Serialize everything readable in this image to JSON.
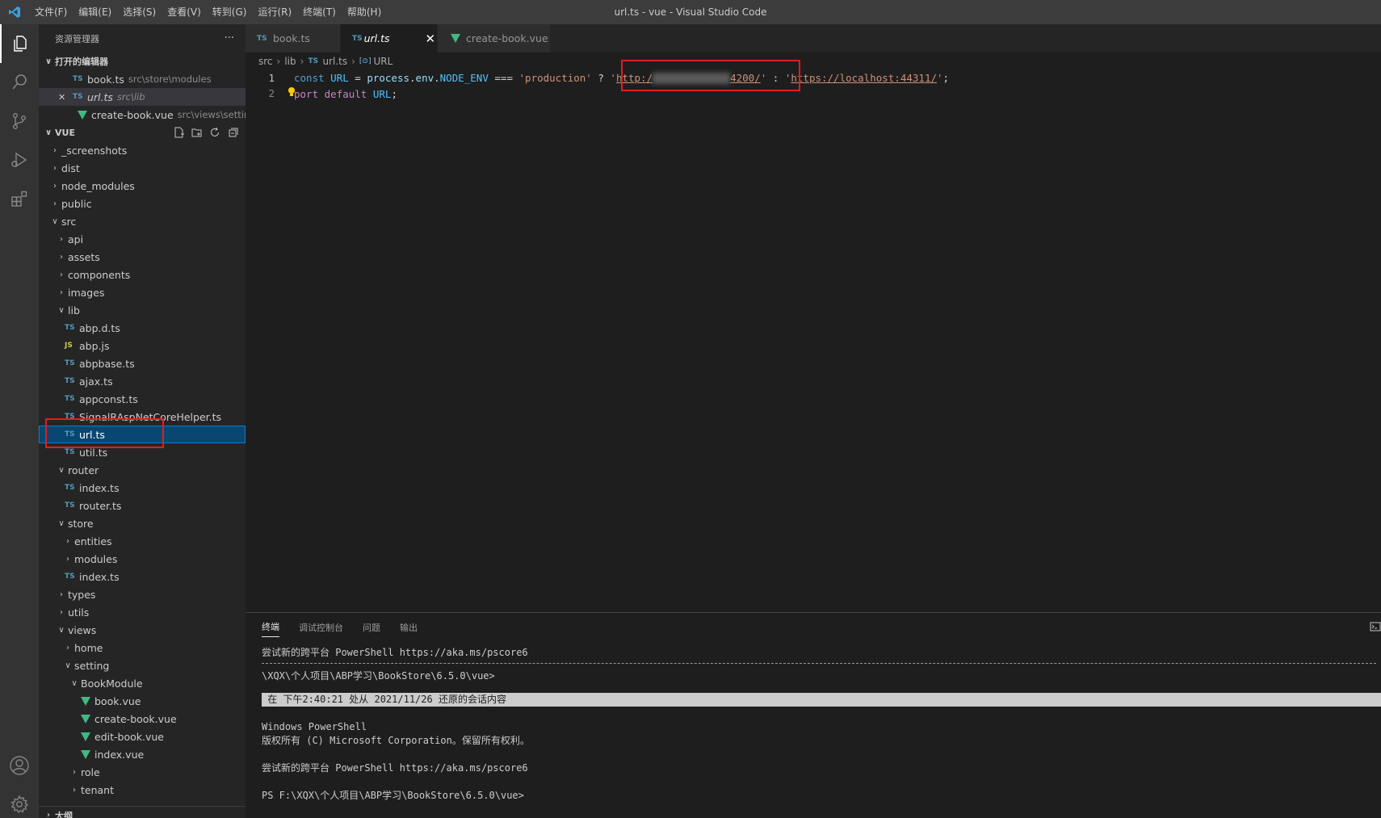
{
  "window": {
    "title": "url.ts - vue - Visual Studio Code"
  },
  "menu": [
    "文件(F)",
    "编辑(E)",
    "选择(S)",
    "查看(V)",
    "转到(G)",
    "运行(R)",
    "终端(T)",
    "帮助(H)"
  ],
  "activity_bar": [
    "explorer-icon",
    "search-icon",
    "source-control-icon",
    "run-debug-icon",
    "extensions-icon",
    "account-icon",
    "gear-icon"
  ],
  "sidebar": {
    "title": "资源管理器",
    "more": "···",
    "open_editors": {
      "title": "打开的编辑器",
      "items": [
        {
          "name": "book.ts",
          "path": "src\\store\\modules"
        },
        {
          "name": "url.ts",
          "path": "src\\lib",
          "close": "✕"
        },
        {
          "name": "create-book.vue",
          "path": "src\\views\\settin..."
        }
      ]
    },
    "workspace": {
      "title": "VUE",
      "tree": [
        "_screenshots",
        "dist",
        "node_modules",
        "public",
        "src",
        "api",
        "assets",
        "components",
        "images",
        "lib",
        "abp.d.ts",
        "abp.js",
        "abpbase.ts",
        "ajax.ts",
        "appconst.ts",
        "SignalRAspNetCoreHelper.ts",
        "url.ts",
        "util.ts",
        "router",
        "index.ts",
        "router.ts",
        "store",
        "entities",
        "modules",
        "index.ts",
        "types",
        "utils",
        "views",
        "home",
        "setting",
        "BookModule",
        "book.vue",
        "create-book.vue",
        "edit-book.vue",
        "index.vue",
        "role",
        "tenant"
      ]
    },
    "outline_title": "大纲"
  },
  "tabs": [
    {
      "label": "book.ts",
      "badge": "TS"
    },
    {
      "label": "url.ts",
      "badge": "TS",
      "close": "✕"
    },
    {
      "label": "create-book.vue"
    }
  ],
  "breadcrumbs": [
    "src",
    "lib",
    "url.ts",
    "URL"
  ],
  "breadcrumb_badge": "TS",
  "breadcrumb_symbol": "[⊙]",
  "code": {
    "line_numbers": [
      "1",
      "2"
    ],
    "l1": {
      "const": "const",
      "name": "URL",
      "eq": " = ",
      "process": "process",
      "dot1": ".",
      "env": "env",
      "dot2": ".",
      "node_env": "NODE_ENV",
      "op": " === ",
      "prod": "'production'",
      "q": " ? ",
      "url1_open": "'",
      "url1_a": "http:/",
      "url1_b": "4200/",
      "url1_close": "'",
      "colon": " : ",
      "url2_open": "'",
      "url2": "https://localhost:44311/",
      "url2_close": "'",
      "semi": ";"
    },
    "l2": {
      "ex": "port",
      "default": "default",
      "name": "URL",
      "semi": ";"
    }
  },
  "panel": {
    "tabs": [
      "终端",
      "调试控制台",
      "问题",
      "输出"
    ],
    "terminal": [
      "尝试新的跨平台 PowerShell https://aka.ms/pscore6",
      "\\XQX\\个人项目\\ABP学习\\BookStore\\6.5.0\\vue>",
      " 在 下午2:40:21 处从 2021/11/26 还原的会话内容",
      "Windows PowerShell",
      "版权所有 (C) Microsoft Corporation。保留所有权利。",
      "尝试新的跨平台 PowerShell https://aka.ms/pscore6",
      "PS F:\\XQX\\个人项目\\ABP学习\\BookStore\\6.5.0\\vue>"
    ]
  },
  "colors": {
    "titlebar": "#3c3c3c",
    "activity": "#333333",
    "sidebar": "#252526",
    "editor": "#1e1e1e",
    "selection": "#094771",
    "annotation": "#e51c1c"
  }
}
